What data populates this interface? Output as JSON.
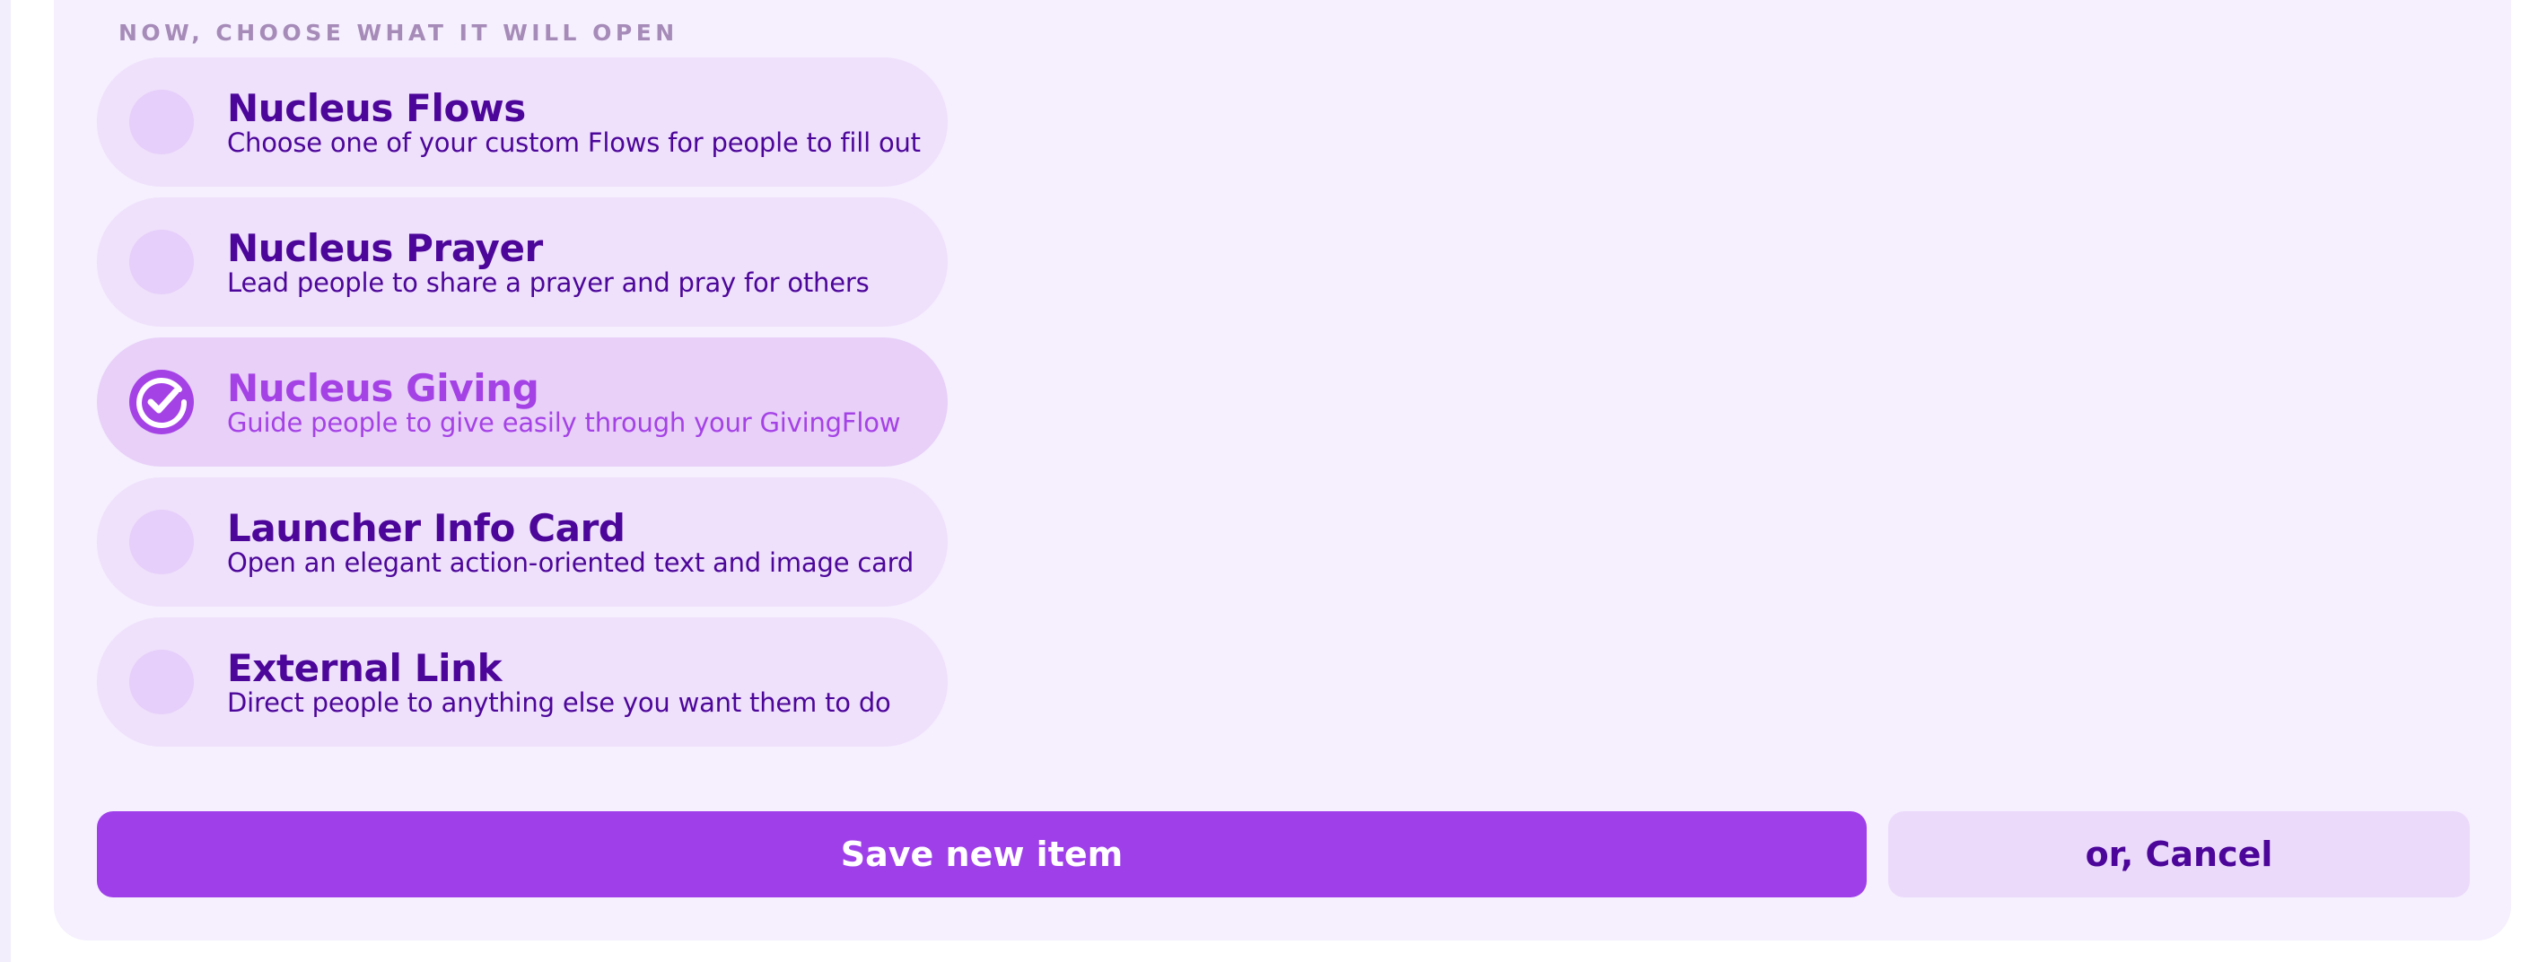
{
  "section_label": "NOW, CHOOSE WHAT IT WILL OPEN",
  "options": [
    {
      "title": "Nucleus Flows",
      "description": "Choose one of your custom Flows for people to fill out",
      "selected": false
    },
    {
      "title": "Nucleus Prayer",
      "description": "Lead people to share a prayer and pray for others",
      "selected": false
    },
    {
      "title": "Nucleus Giving",
      "description": "Guide people to give easily through your GivingFlow",
      "selected": true
    },
    {
      "title": "Launcher Info Card",
      "description": "Open an elegant action-oriented text and image card",
      "selected": false
    },
    {
      "title": "External Link",
      "description": "Direct people to anything else you want them to do",
      "selected": false
    }
  ],
  "actions": {
    "save_label": "Save new item",
    "cancel_label": "or, Cancel"
  },
  "colors": {
    "panel_background": "#f5effe",
    "option_background": "#efe0fb",
    "option_selected_background": "#e8d0f8",
    "primary_text": "#4c0699",
    "accent": "#9f3fea",
    "selected_text": "#a542e6",
    "section_label": "#a68bb8"
  }
}
